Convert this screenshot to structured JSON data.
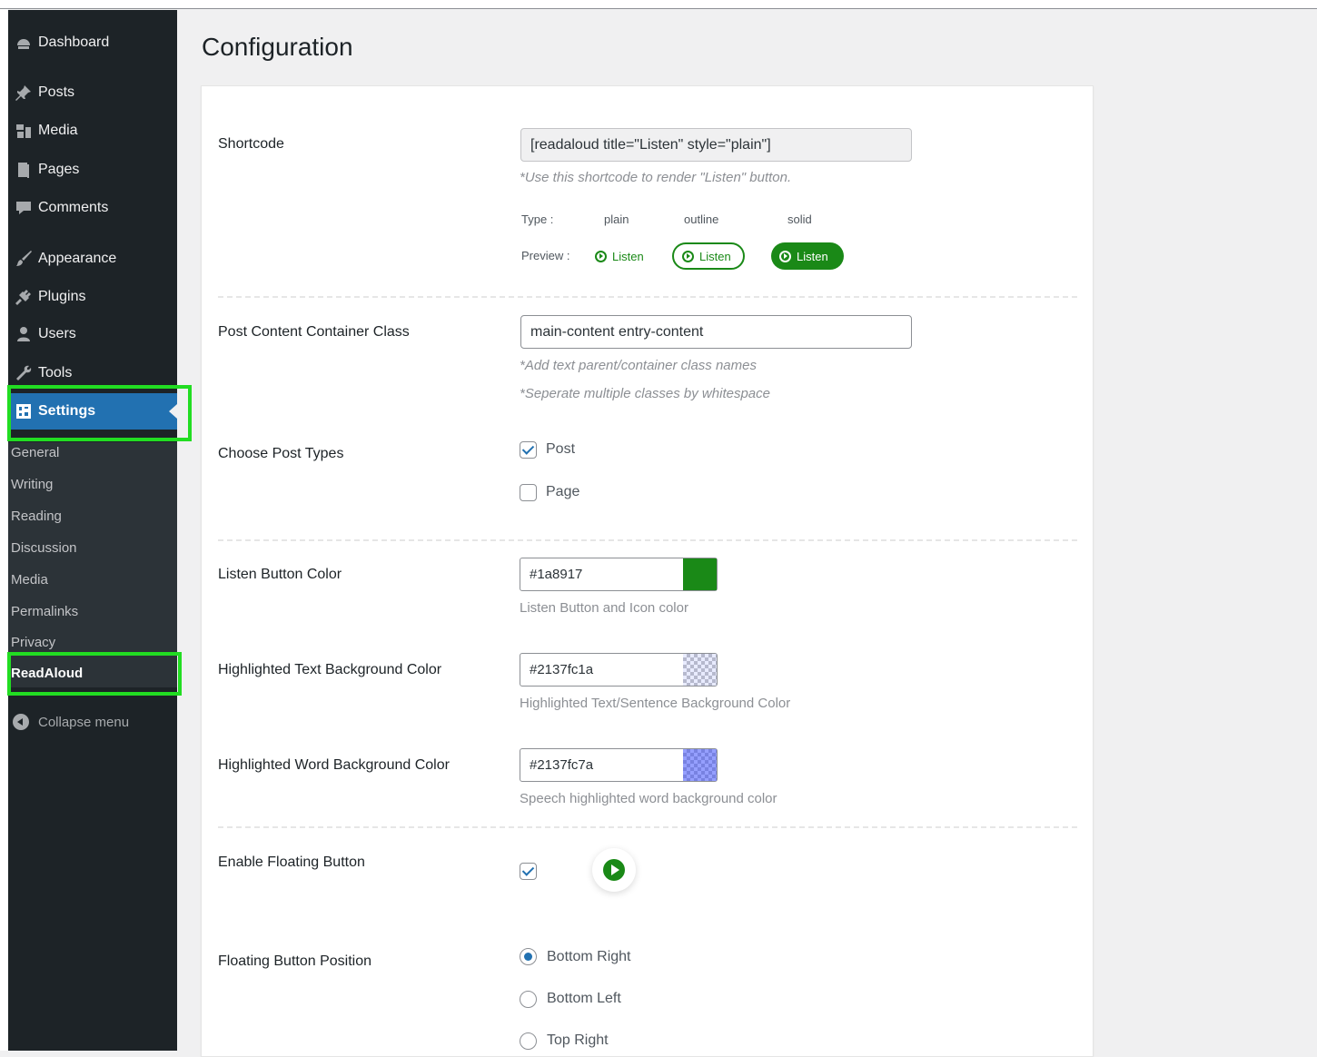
{
  "sidebar": {
    "items": [
      {
        "label": "Dashboard",
        "icon": "dashboard-icon"
      },
      {
        "label": "Posts",
        "icon": "pushpin-icon"
      },
      {
        "label": "Media",
        "icon": "media-icon"
      },
      {
        "label": "Pages",
        "icon": "pages-icon"
      },
      {
        "label": "Comments",
        "icon": "comment-icon"
      },
      {
        "label": "Appearance",
        "icon": "paintbrush-icon"
      },
      {
        "label": "Plugins",
        "icon": "plug-icon"
      },
      {
        "label": "Users",
        "icon": "user-icon"
      },
      {
        "label": "Tools",
        "icon": "wrench-icon"
      },
      {
        "label": "Settings",
        "icon": "settings-icon"
      }
    ],
    "submenu": [
      "General",
      "Writing",
      "Reading",
      "Discussion",
      "Media",
      "Permalinks",
      "Privacy",
      "ReadAloud"
    ],
    "collapse_label": "Collapse menu",
    "active_color": "#2271b1",
    "highlight_color": "#22dd22"
  },
  "page": {
    "title": "Configuration"
  },
  "shortcode": {
    "label": "Shortcode",
    "value": "[readaloud title=\"Listen\" style=\"plain\"]",
    "hint": "*Use this shortcode to render \"Listen\" button.",
    "type_label": "Type :",
    "preview_label": "Preview :",
    "types": [
      "plain",
      "outline",
      "solid"
    ],
    "preview_button_label": "Listen"
  },
  "container_class": {
    "label": "Post Content Container Class",
    "value": "main-content entry-content",
    "hint1": "*Add text parent/container class names",
    "hint2": "*Seperate multiple classes by whitespace"
  },
  "post_types": {
    "label": "Choose Post Types",
    "options": [
      {
        "label": "Post",
        "checked": true
      },
      {
        "label": "Page",
        "checked": false
      }
    ]
  },
  "listen_color": {
    "label": "Listen Button Color",
    "value": "#1a8917",
    "hint": "Listen Button and Icon color"
  },
  "highlight_text_color": {
    "label": "Highlighted Text Background Color",
    "value": "#2137fc1a",
    "hint": "Highlighted Text/Sentence Background Color"
  },
  "highlight_word_color": {
    "label": "Highlighted Word Background Color",
    "value": "#2137fc7a",
    "hint": "Speech highlighted word background color"
  },
  "floating": {
    "label": "Enable Floating Button",
    "checked": true,
    "icon": "play-circle-icon"
  },
  "floating_position": {
    "label": "Floating Button Position",
    "options": [
      {
        "label": "Bottom Right",
        "selected": true
      },
      {
        "label": "Bottom Left",
        "selected": false
      },
      {
        "label": "Top Right",
        "selected": false
      }
    ]
  }
}
